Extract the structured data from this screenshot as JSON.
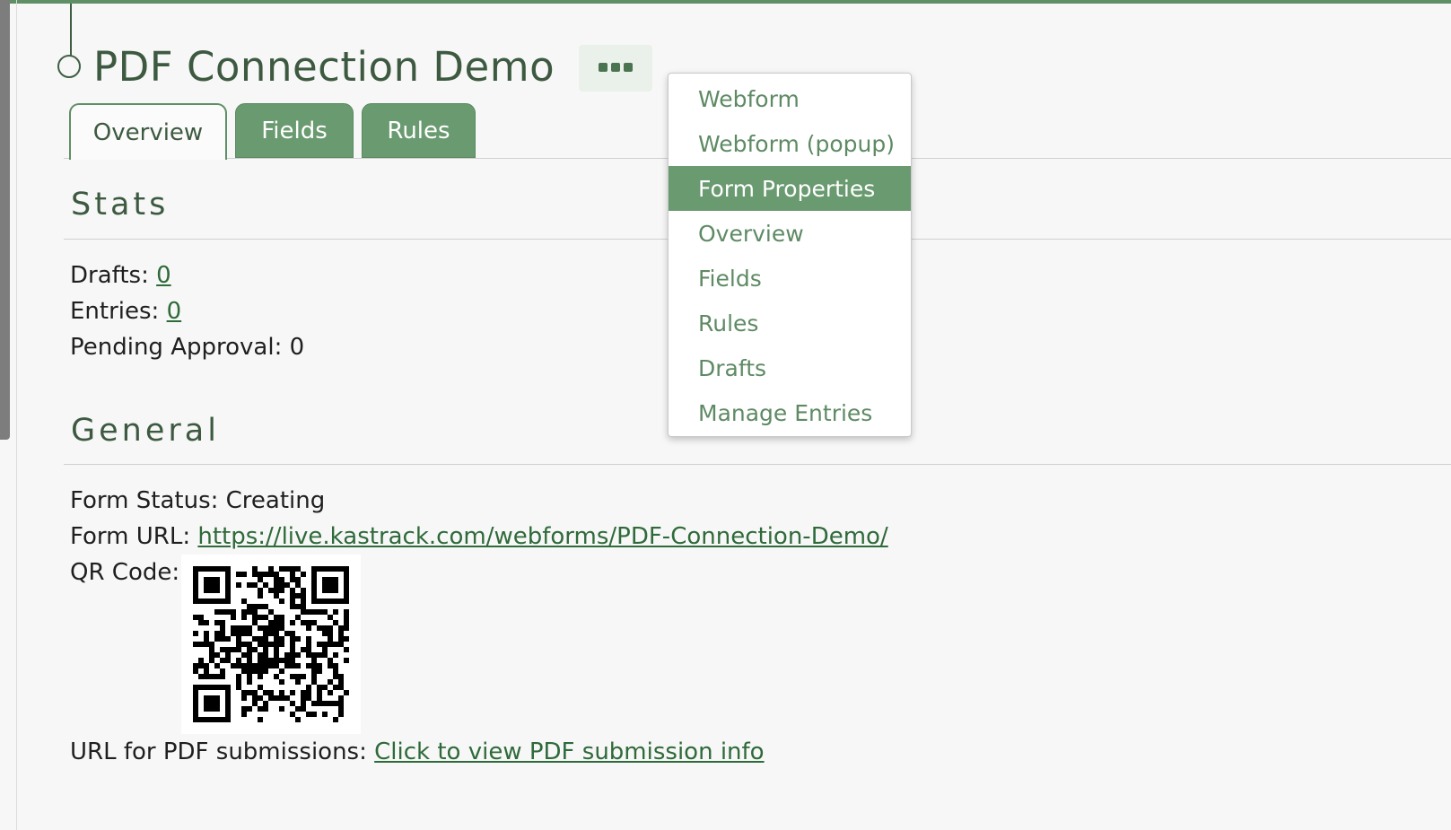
{
  "page": {
    "title": "PDF Connection Demo"
  },
  "tabs": [
    {
      "label": "Overview",
      "active": true
    },
    {
      "label": "Fields",
      "active": false
    },
    {
      "label": "Rules",
      "active": false
    }
  ],
  "more_button": {
    "icon": "ellipsis-icon"
  },
  "stats": {
    "heading": "Stats",
    "drafts_label": "Drafts:",
    "drafts_value": "0",
    "entries_label": "Entries:",
    "entries_value": "0",
    "pending_label": "Pending Approval:",
    "pending_value": "0"
  },
  "general": {
    "heading": "General",
    "status_label": "Form Status:",
    "status_value": "Creating",
    "url_label": "Form URL:",
    "url_value": "https://live.kastrack.com/webforms/PDF-Connection-Demo/",
    "qr_label": "QR Code:",
    "pdf_label": "URL for PDF submissions:",
    "pdf_link": "Click to view PDF submission info"
  },
  "dropdown": {
    "items": [
      {
        "label": "Webform",
        "active": false
      },
      {
        "label": "Webform (popup)",
        "active": false
      },
      {
        "label": "Form Properties",
        "active": true
      },
      {
        "label": "Overview",
        "active": false
      },
      {
        "label": "Fields",
        "active": false
      },
      {
        "label": "Rules",
        "active": false
      },
      {
        "label": "Drafts",
        "active": false
      },
      {
        "label": "Manage Entries",
        "active": false
      }
    ]
  },
  "colors": {
    "accent": "#6a9a70",
    "title": "#3d5a41",
    "link": "#2f6a3a"
  }
}
